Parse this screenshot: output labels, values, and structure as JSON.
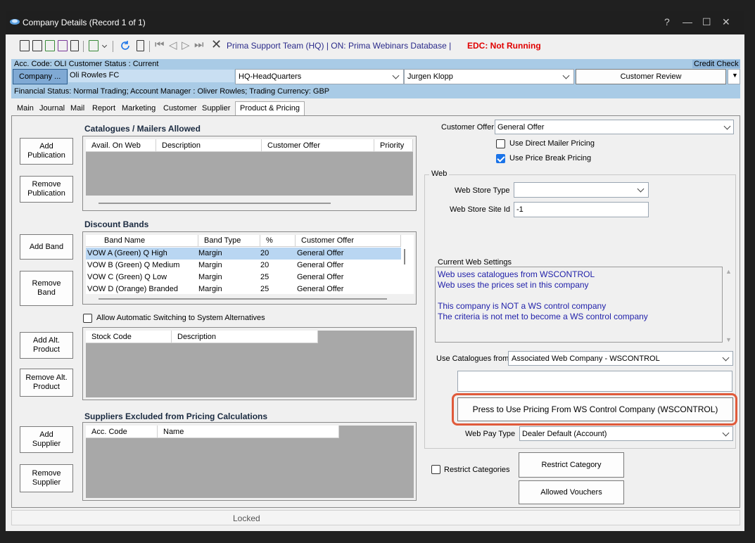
{
  "window": {
    "title": "Company Details  (Record 1 of 1)",
    "controls": [
      "?",
      "—",
      "☐",
      "✕"
    ]
  },
  "toolbar": {
    "status_team": "Prima Support Team  (HQ) | ON: Prima Webinars Database |",
    "status_edc": "EDC: Not Running"
  },
  "account": {
    "header": "Acc. Code: OLI  Customer Status : Current",
    "credit_check": "Credit Check",
    "company_button": "Company ...",
    "company_name": "Oli Rowles FC",
    "headquarters": "HQ-HeadQuarters",
    "manager_select": "Jurgen Klopp",
    "review_button": "Customer Review",
    "financial_status": "Financial Status: Normal Trading;  Account Manager : Oliver Rowles; Trading Currency: GBP"
  },
  "tabs": [
    "Main",
    "Journal",
    "Mail",
    "Report",
    "Marketing",
    "Customer",
    "Supplier",
    "Product & Pricing"
  ],
  "active_tab": "Product & Pricing",
  "catalogues": {
    "title": "Catalogues / Mailers Allowed",
    "columns": [
      "Avail. On Web",
      "Description",
      "Customer Offer",
      "Priority"
    ],
    "add_button": "Add\nPublication",
    "remove_button": "Remove\nPublication"
  },
  "discount_bands": {
    "title": "Discount Bands",
    "columns": [
      "Band Name",
      "Band Type",
      "%",
      "Customer Offer"
    ],
    "rows": [
      {
        "name": "VOW A (Green) Q High",
        "type": "Margin",
        "pct": "20",
        "offer": "General Offer"
      },
      {
        "name": "VOW B (Green) Q Medium",
        "type": "Margin",
        "pct": "20",
        "offer": "General Offer"
      },
      {
        "name": "VOW C (Green) Q Low",
        "type": "Margin",
        "pct": "25",
        "offer": "General Offer"
      },
      {
        "name": "VOW D (Orange) Branded",
        "type": "Margin",
        "pct": "25",
        "offer": "General Offer"
      }
    ],
    "add_button": "Add Band",
    "remove_button": "Remove\nBand"
  },
  "alternatives": {
    "checkbox_label": "Allow Automatic Switching to System Alternatives",
    "checked": false,
    "columns": [
      "Stock Code",
      "Description"
    ],
    "add_button": "Add Alt.\nProduct",
    "remove_button": "Remove Alt.\nProduct"
  },
  "suppliers_excluded": {
    "title": "Suppliers Excluded from Pricing Calculations",
    "columns": [
      "Acc. Code",
      "Name"
    ],
    "add_button": "Add\nSupplier",
    "remove_button": "Remove\nSupplier"
  },
  "pricing": {
    "customer_offer_label": "Customer Offer",
    "customer_offer_value": "General Offer",
    "direct_mailer_label": "Use Direct Mailer Pricing",
    "direct_mailer_checked": false,
    "price_break_label": "Use Price Break Pricing",
    "price_break_checked": true
  },
  "web": {
    "group_label": "Web",
    "store_type_label": "Web Store Type",
    "store_type_value": "",
    "store_site_label": "Web Store Site Id",
    "store_site_value": "-1",
    "current_settings_label": "Current Web Settings",
    "current_settings_lines": [
      "Web uses catalogues from WSCONTROL",
      "Web uses the prices set in this company",
      "",
      "This company is NOT a WS control company",
      "The criteria is not met to become a WS control company"
    ],
    "use_catalogues_label": "Use Catalogues from",
    "use_catalogues_value": "Associated Web Company - WSCONTROL",
    "ws_pricing_button": "Press to Use Pricing From WS Control Company (WSCONTROL)",
    "pay_type_label": "Web Pay Type",
    "pay_type_value": "Dealer Default (Account)",
    "restrict_categories_label": "Restrict Categories",
    "restrict_categories_checked": false,
    "restrict_category_button": "Restrict Category",
    "allowed_vouchers_button": "Allowed Vouchers"
  },
  "status_bar": {
    "locked": "Locked"
  },
  "colors": {
    "accent_highlight": "#e05a3a",
    "account_bar": "#a9cbe6",
    "selected_row": "#b9d6f2",
    "web_text": "#2222aa",
    "edc_red": "#e00000"
  }
}
